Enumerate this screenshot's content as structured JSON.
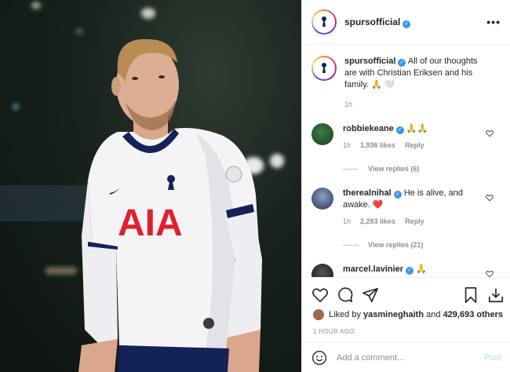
{
  "post": {
    "username": "spursofficial",
    "more_label": "•••",
    "caption": "All of our thoughts are with Christian Eriksen and his family.",
    "caption_emoji": "🙏 🤍",
    "caption_time": "1h",
    "jersey_sponsor": "AIA"
  },
  "comments": [
    {
      "username": "robbiekeane",
      "text": "🙏🙏",
      "time": "1h",
      "likes": "1,936 likes",
      "reply": "Reply",
      "view_replies": "View replies (6)"
    },
    {
      "username": "therealnihal",
      "text": "He is alive, and awake. ❤️",
      "time": "1h",
      "likes": "2,283 likes",
      "reply": "Reply",
      "view_replies": "View replies (21)"
    },
    {
      "username": "marcel.lavinier",
      "text": "🙏"
    }
  ],
  "likes": {
    "liked_by_prefix": "Liked by ",
    "liked_by_user": "yasmineghaith",
    "and": " and ",
    "others": "429,693 others"
  },
  "timestamp": "1 HOUR AGO",
  "add_comment": {
    "placeholder": "Add a comment...",
    "post_label": "Post"
  },
  "colors": {
    "verified": "#3897f0",
    "post_disabled": "#b2dffc",
    "navy": "#132257"
  }
}
